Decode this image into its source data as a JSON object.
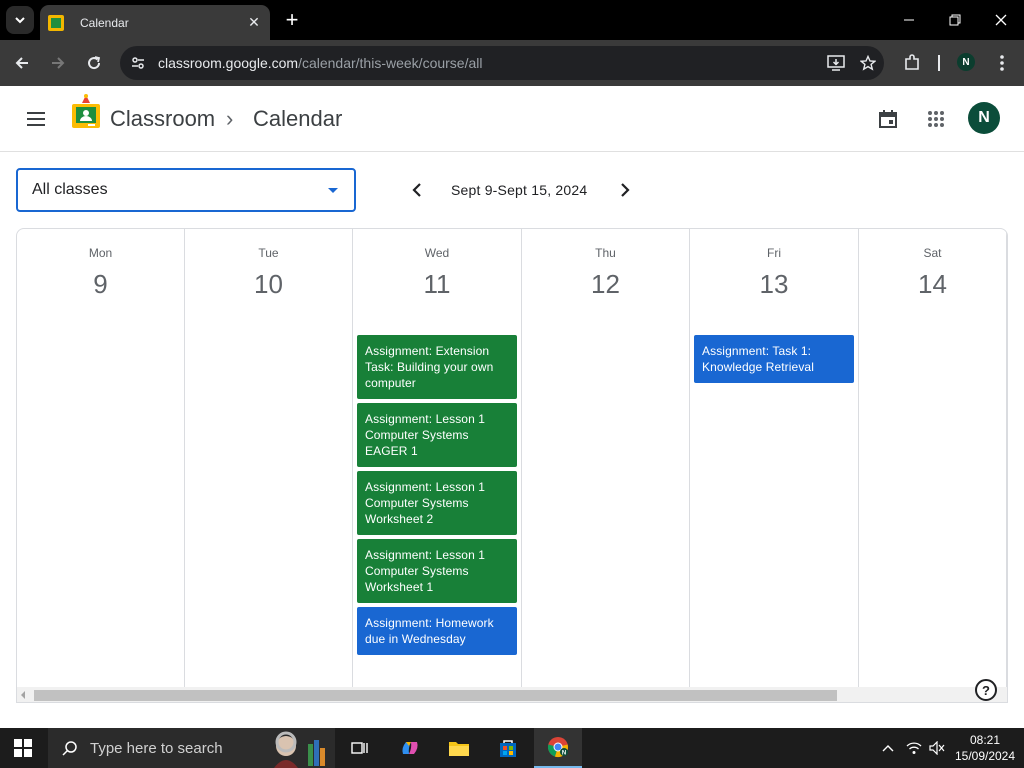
{
  "browser": {
    "tab_title": "Calendar",
    "url_host": "classroom.google.com",
    "url_path": "/calendar/this-week/course/all",
    "profile_initial": "N"
  },
  "app": {
    "brand": "Classroom",
    "breadcrumb_sep": "›",
    "current_page": "Calendar",
    "avatar_initial": "N"
  },
  "controls": {
    "class_select_value": "All classes",
    "week_range": "Sept 9-Sept 15, 2024"
  },
  "calendar": {
    "days": [
      {
        "name": "Mon",
        "num": "9",
        "events": []
      },
      {
        "name": "Tue",
        "num": "10",
        "events": []
      },
      {
        "name": "Wed",
        "num": "11",
        "events": [
          {
            "text": "Assignment: Extension Task: Building your own computer",
            "color": "#188038"
          },
          {
            "text": "Assignment: Lesson 1 Computer Systems EAGER 1",
            "color": "#188038"
          },
          {
            "text": "Assignment: Lesson 1 Computer Systems Worksheet 2",
            "color": "#188038"
          },
          {
            "text": "Assignment: Lesson 1 Computer Systems Worksheet 1",
            "color": "#188038"
          },
          {
            "text": "Assignment: Homework due in Wednesday",
            "color": "#1967d2"
          }
        ]
      },
      {
        "name": "Thu",
        "num": "12",
        "events": []
      },
      {
        "name": "Fri",
        "num": "13",
        "events": [
          {
            "text": "Assignment: Task 1: Knowledge Retrieval",
            "color": "#1967d2"
          }
        ]
      },
      {
        "name": "Sat",
        "num": "14",
        "events": []
      }
    ]
  },
  "help_label": "?",
  "taskbar": {
    "search_placeholder": "Type here to search",
    "time": "08:21",
    "date": "15/09/2024"
  },
  "colors": {
    "green_event": "#188038",
    "blue_event": "#1967d2",
    "select_border": "#1967d2"
  }
}
